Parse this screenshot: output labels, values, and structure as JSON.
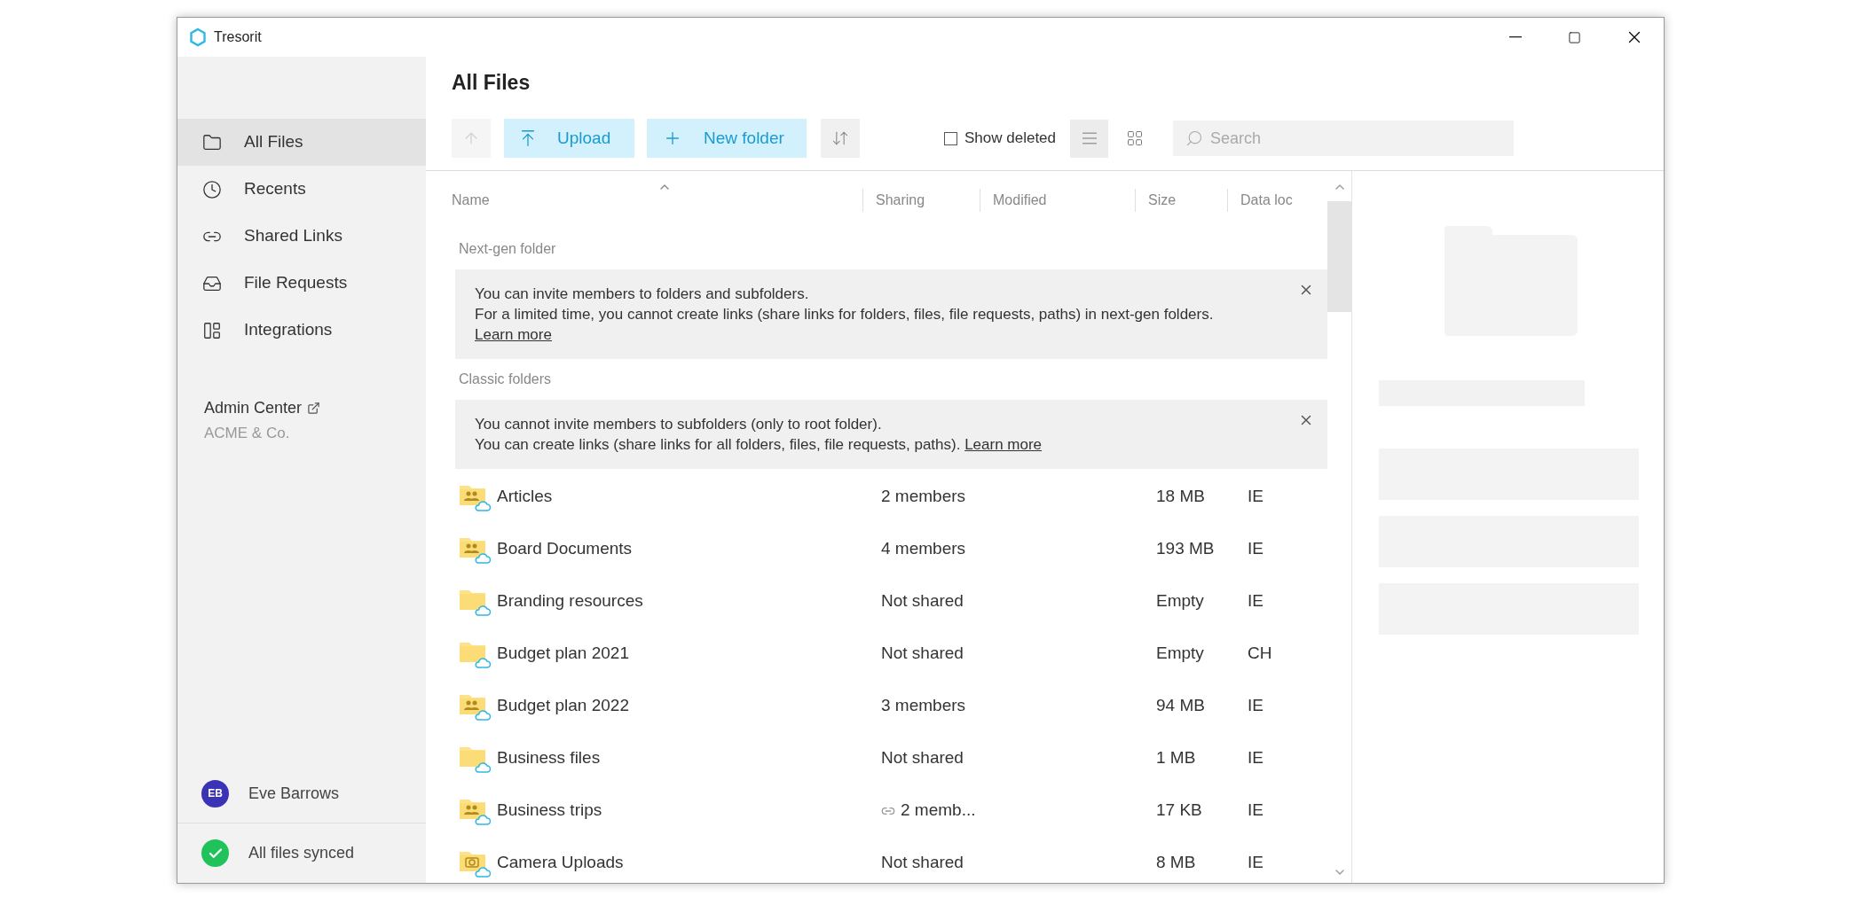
{
  "window": {
    "title": "Tresorit"
  },
  "sidebar": {
    "items": [
      {
        "label": "All Files",
        "selected": true
      },
      {
        "label": "Recents",
        "selected": false
      },
      {
        "label": "Shared Links",
        "selected": false
      },
      {
        "label": "File Requests",
        "selected": false
      },
      {
        "label": "Integrations",
        "selected": false
      }
    ],
    "admin": {
      "label": "Admin Center",
      "org": "ACME & Co."
    },
    "user": {
      "initials": "EB",
      "name": "Eve Barrows"
    },
    "sync_status": "All files synced"
  },
  "main": {
    "title": "All Files",
    "toolbar": {
      "upload": "Upload",
      "new_folder": "New folder",
      "show_deleted": {
        "label": "Show deleted",
        "checked": false
      },
      "views": [
        {
          "kind": "list",
          "selected": true
        },
        {
          "kind": "grid",
          "selected": false
        }
      ],
      "search": {
        "placeholder": "Search"
      }
    },
    "table": {
      "columns": [
        {
          "label": "Name",
          "sorted": true
        },
        {
          "label": "Sharing",
          "sorted": false
        },
        {
          "label": "Modified",
          "sorted": false
        },
        {
          "label": "Size",
          "sorted": false
        },
        {
          "label": "Data loc",
          "sorted": false
        }
      ],
      "sections": [
        {
          "label": "Next-gen folder",
          "notice": {
            "lines": [
              "You can invite members to folders and subfolders.",
              "For a limited time, you cannot create links (share links for folders, files, file requests, paths) in next-gen folders."
            ],
            "link": "Learn more"
          }
        },
        {
          "label": "Classic folders",
          "notice": {
            "lines": [
              "You cannot invite members to subfolders (only to root folder).",
              "You can create links (share links for all folders, files, file requests, paths)."
            ],
            "link": "Learn more"
          }
        }
      ],
      "rows": [
        {
          "name": "Articles",
          "kind": "shared",
          "sharing": "2 members",
          "link": false,
          "size": "18 MB",
          "location": "IE"
        },
        {
          "name": "Board Documents",
          "kind": "shared",
          "sharing": "4 members",
          "link": false,
          "size": "193 MB",
          "location": "IE"
        },
        {
          "name": "Branding resources",
          "kind": "plain",
          "sharing": "Not shared",
          "link": false,
          "size": "Empty",
          "location": "IE"
        },
        {
          "name": "Budget plan 2021",
          "kind": "plain",
          "sharing": "Not shared",
          "link": false,
          "size": "Empty",
          "location": "CH"
        },
        {
          "name": "Budget plan 2022",
          "kind": "shared",
          "sharing": "3 members",
          "link": false,
          "size": "94 MB",
          "location": "IE"
        },
        {
          "name": "Business files",
          "kind": "plain",
          "sharing": "Not shared",
          "link": false,
          "size": "1 MB",
          "location": "IE"
        },
        {
          "name": "Business trips",
          "kind": "shared",
          "sharing": "2 memb...",
          "link": true,
          "size": "17 KB",
          "location": "IE"
        },
        {
          "name": "Camera Uploads",
          "kind": "camera",
          "sharing": "Not shared",
          "link": false,
          "size": "8 MB",
          "location": "IE"
        }
      ]
    }
  }
}
